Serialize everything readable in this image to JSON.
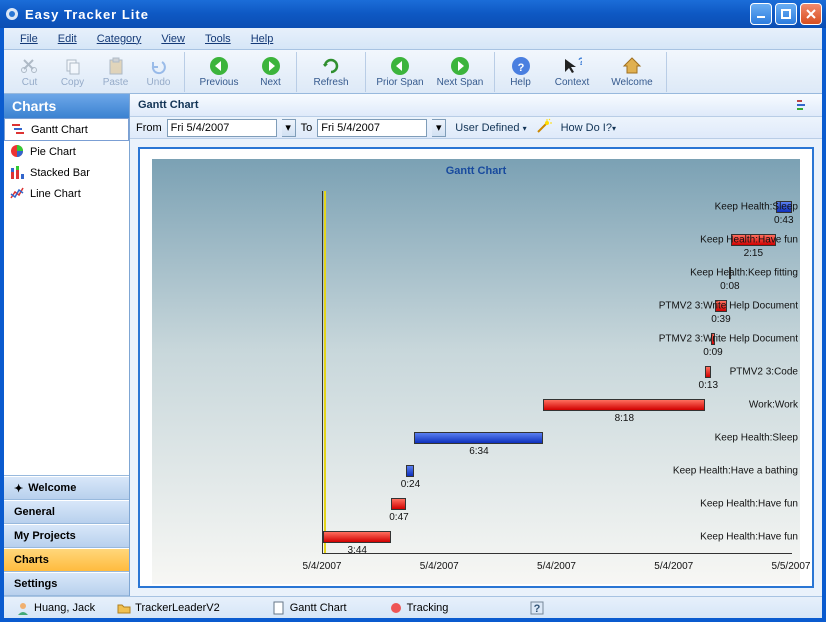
{
  "app": {
    "title": "Easy Tracker Lite"
  },
  "menu": {
    "file": "File",
    "edit": "Edit",
    "category": "Category",
    "view": "View",
    "tools": "Tools",
    "help": "Help"
  },
  "toolbar": {
    "cut": "Cut",
    "copy": "Copy",
    "paste": "Paste",
    "undo": "Undo",
    "previous": "Previous",
    "next": "Next",
    "refresh": "Refresh",
    "prior": "Prior Span",
    "nextspan": "Next Span",
    "help": "Help",
    "context": "Context",
    "welcome": "Welcome"
  },
  "sidebar": {
    "header": "Charts",
    "items": [
      {
        "label": "Gantt Chart"
      },
      {
        "label": "Pie Chart"
      },
      {
        "label": "Stacked Bar"
      },
      {
        "label": "Line Chart"
      }
    ],
    "stack": {
      "welcome": "Welcome",
      "general": "General",
      "projects": "My Projects",
      "charts": "Charts",
      "settings": "Settings"
    }
  },
  "page": {
    "title": "Gantt Chart",
    "from_label": "From",
    "to_label": "To",
    "from": "Fri 5/4/2007",
    "to": "Fri 5/4/2007",
    "userdef": "User Defined",
    "howdoi": "How Do I?"
  },
  "chart_data": {
    "type": "gantt",
    "title": "Gantt Chart",
    "xticks": [
      "5/4/2007",
      "5/4/2007",
      "5/4/2007",
      "5/4/2007",
      "5/5/2007"
    ],
    "tasks": [
      {
        "label": "Keep Health:Sleep",
        "color": "blue",
        "start": 0.965,
        "end": 1.0,
        "dur": "0:43"
      },
      {
        "label": "Keep Health:Have fun",
        "color": "red",
        "start": 0.87,
        "end": 0.965,
        "dur": "2:15"
      },
      {
        "label": "Keep Health:Keep fitting",
        "color": "blue",
        "start": 0.865,
        "end": 0.87,
        "dur": "0:08"
      },
      {
        "label": "PTMV2 3:Write Help Document",
        "color": "red",
        "start": 0.835,
        "end": 0.862,
        "dur": "0:39"
      },
      {
        "label": "PTMV2 3:Write Help Document",
        "color": "red",
        "start": 0.828,
        "end": 0.835,
        "dur": "0:09"
      },
      {
        "label": "PTMV2 3:Code",
        "color": "red",
        "start": 0.815,
        "end": 0.828,
        "dur": "0:13"
      },
      {
        "label": "Work:Work",
        "color": "red",
        "start": 0.47,
        "end": 0.815,
        "dur": "8:18"
      },
      {
        "label": "Keep Health:Sleep",
        "color": "blue",
        "start": 0.195,
        "end": 0.47,
        "dur": "6:34"
      },
      {
        "label": "Keep Health:Have a bathing",
        "color": "blue",
        "start": 0.178,
        "end": 0.195,
        "dur": "0:24"
      },
      {
        "label": "Keep Health:Have fun",
        "color": "red",
        "start": 0.146,
        "end": 0.178,
        "dur": "0:47"
      },
      {
        "label": "Keep Health:Have fun",
        "color": "red",
        "start": 0.0,
        "end": 0.146,
        "dur": "3:44"
      }
    ]
  },
  "status": {
    "user": "Huang, Jack",
    "proj": "TrackerLeaderV2",
    "doc": "Gantt Chart",
    "act": "Tracking"
  }
}
